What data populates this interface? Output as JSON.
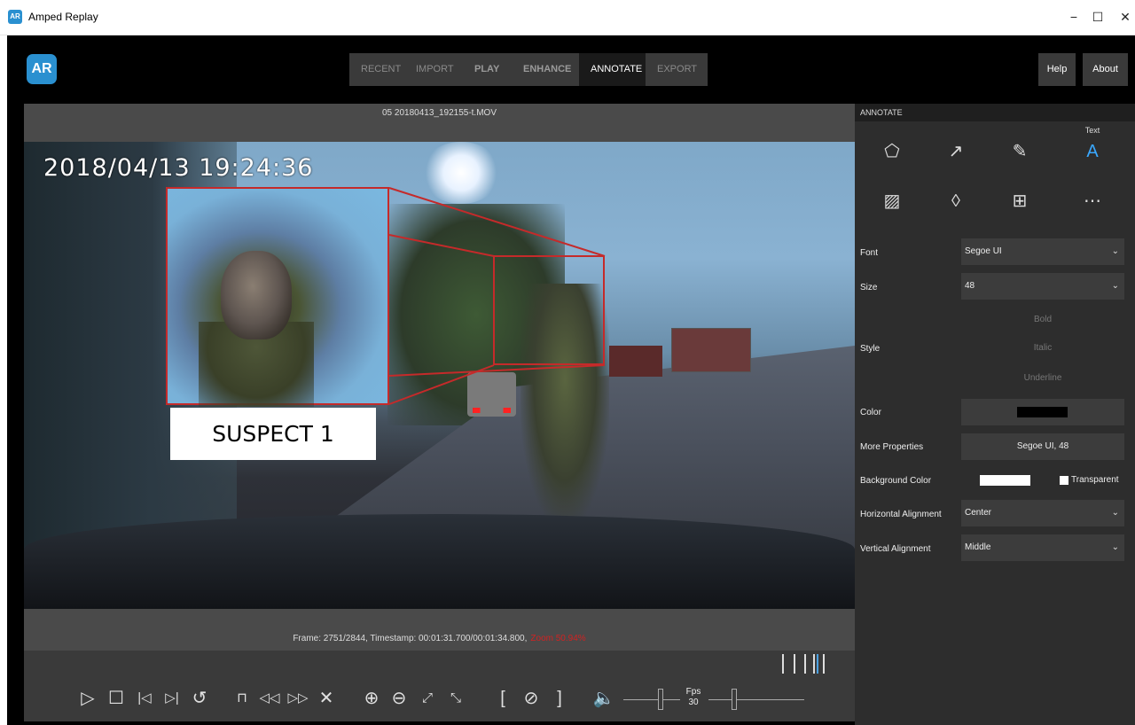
{
  "window": {
    "title": "Amped Replay",
    "minimize_glyph": "−",
    "maximize_glyph": "☐",
    "close_glyph": "✕"
  },
  "nav": {
    "tabs": [
      {
        "label": "RECENT"
      },
      {
        "label": "IMPORT"
      },
      {
        "label": "PLAY"
      },
      {
        "label": "ENHANCE"
      },
      {
        "label": "ANNOTATE"
      },
      {
        "label": "EXPORT"
      }
    ],
    "active_tab": "ANNOTATE",
    "help_label": "Help",
    "about_label": "About"
  },
  "viewer": {
    "filename": "05 20180413_192155-t.MOV",
    "video_timestamp": "2018/04/13   19:24:36",
    "annotation_label": "SUSPECT 1",
    "frame_info": "Frame: 2751/2844, Timestamp: 00:01:31.700/00:01:34.800,",
    "zoom_info": "Zoom 50.94%",
    "zoom_color": "#d02222"
  },
  "controls": {
    "fps_label": "Fps",
    "fps_value": "30",
    "icons": [
      "play-icon",
      "stop-icon",
      "previous-frame-icon",
      "next-frame-icon",
      "loop-icon",
      "bookmark-icon",
      "rewind-icon",
      "fast-forward-icon",
      "close-icon",
      "zoom-in-icon",
      "zoom-out-icon",
      "expand-icon",
      "collapse-icon",
      "mark-in-icon",
      "clear-marks-icon",
      "mark-out-icon",
      "volume-icon"
    ]
  },
  "panel": {
    "header": "ANNOTATE",
    "text_tool_label": "Text",
    "tools": [
      "shape-icon",
      "arrow-icon",
      "pencil-icon",
      "text-icon",
      "image-icon",
      "blur-icon",
      "magnify-icon",
      "more-icon"
    ],
    "font_label": "Font",
    "font_value": "Segoe UI",
    "size_label": "Size",
    "size_value": "48",
    "style_label": "Style",
    "bold_label": "Bold",
    "italic_label": "Italic",
    "underline_label": "Underline",
    "color_label": "Color",
    "color_value": "#000000",
    "more_properties_label": "More Properties",
    "more_properties_value": "Segoe UI, 48",
    "background_color_label": "Background Color",
    "background_color_value": "#ffffff",
    "transparent_label": "Transparent",
    "horizontal_alignment_label": "Horizontal Alignment",
    "horizontal_alignment_value": "Center",
    "vertical_alignment_label": "Vertical Alignment",
    "vertical_alignment_value": "Middle",
    "accent_color": "#3aa8ff"
  }
}
